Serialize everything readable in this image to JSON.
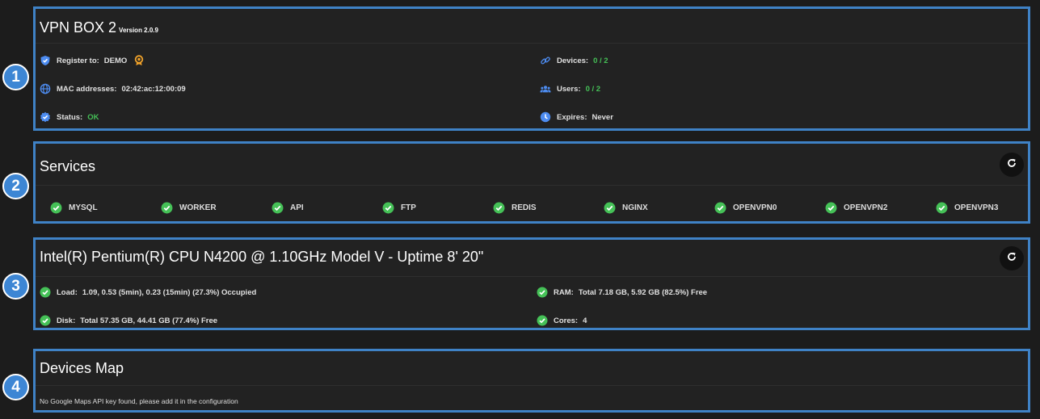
{
  "markers": [
    "1",
    "2",
    "3",
    "4"
  ],
  "box": {
    "title": "VPN BOX 2",
    "version": "Version 2.0.9",
    "register_label": "Register to:",
    "register_value": "DEMO",
    "mac_label": "MAC addresses:",
    "mac_value": "02:42:ac:12:00:09",
    "status_label": "Status:",
    "status_value": "OK",
    "devices_label": "Devices:",
    "devices_value": "0 / 2",
    "users_label": "Users:",
    "users_value": "0 / 2",
    "expires_label": "Expires:",
    "expires_value": "Never"
  },
  "services": {
    "title": "Services",
    "items": [
      "MYSQL",
      "WORKER",
      "API",
      "FTP",
      "REDIS",
      "NGINX",
      "OPENVPN0",
      "OPENVPN2",
      "OPENVPN3"
    ]
  },
  "system": {
    "title": "Intel(R) Pentium(R) CPU N4200 @ 1.10GHz Model V - Uptime 8' 20\"",
    "load_label": "Load:",
    "load_value": "1.09, 0.53 (5min), 0.23 (15min) (27.3%) Occupied",
    "disk_label": "Disk:",
    "disk_value": "Total 57.35 GB, 44.41 GB (77.4%) Free",
    "ram_label": "RAM:",
    "ram_value": "Total 7.18 GB, 5.92 GB (82.5%) Free",
    "cores_label": "Cores:",
    "cores_value": "4"
  },
  "map": {
    "title": "Devices Map",
    "message": "No Google Maps API key found, please add it in the configuration"
  },
  "colors": {
    "accent": "#3f82c6",
    "ok_green": "#45c157",
    "icon_blue": "#4d8cf0",
    "award_orange": "#f0a22a"
  },
  "icons": {
    "register": "shield-check-icon",
    "award": "award-icon",
    "mac": "globe-icon",
    "status": "badge-check-icon",
    "devices": "link-icon",
    "users": "users-icon",
    "expires": "clock-icon",
    "service": "check-circle-icon",
    "refresh": "refresh-icon"
  }
}
